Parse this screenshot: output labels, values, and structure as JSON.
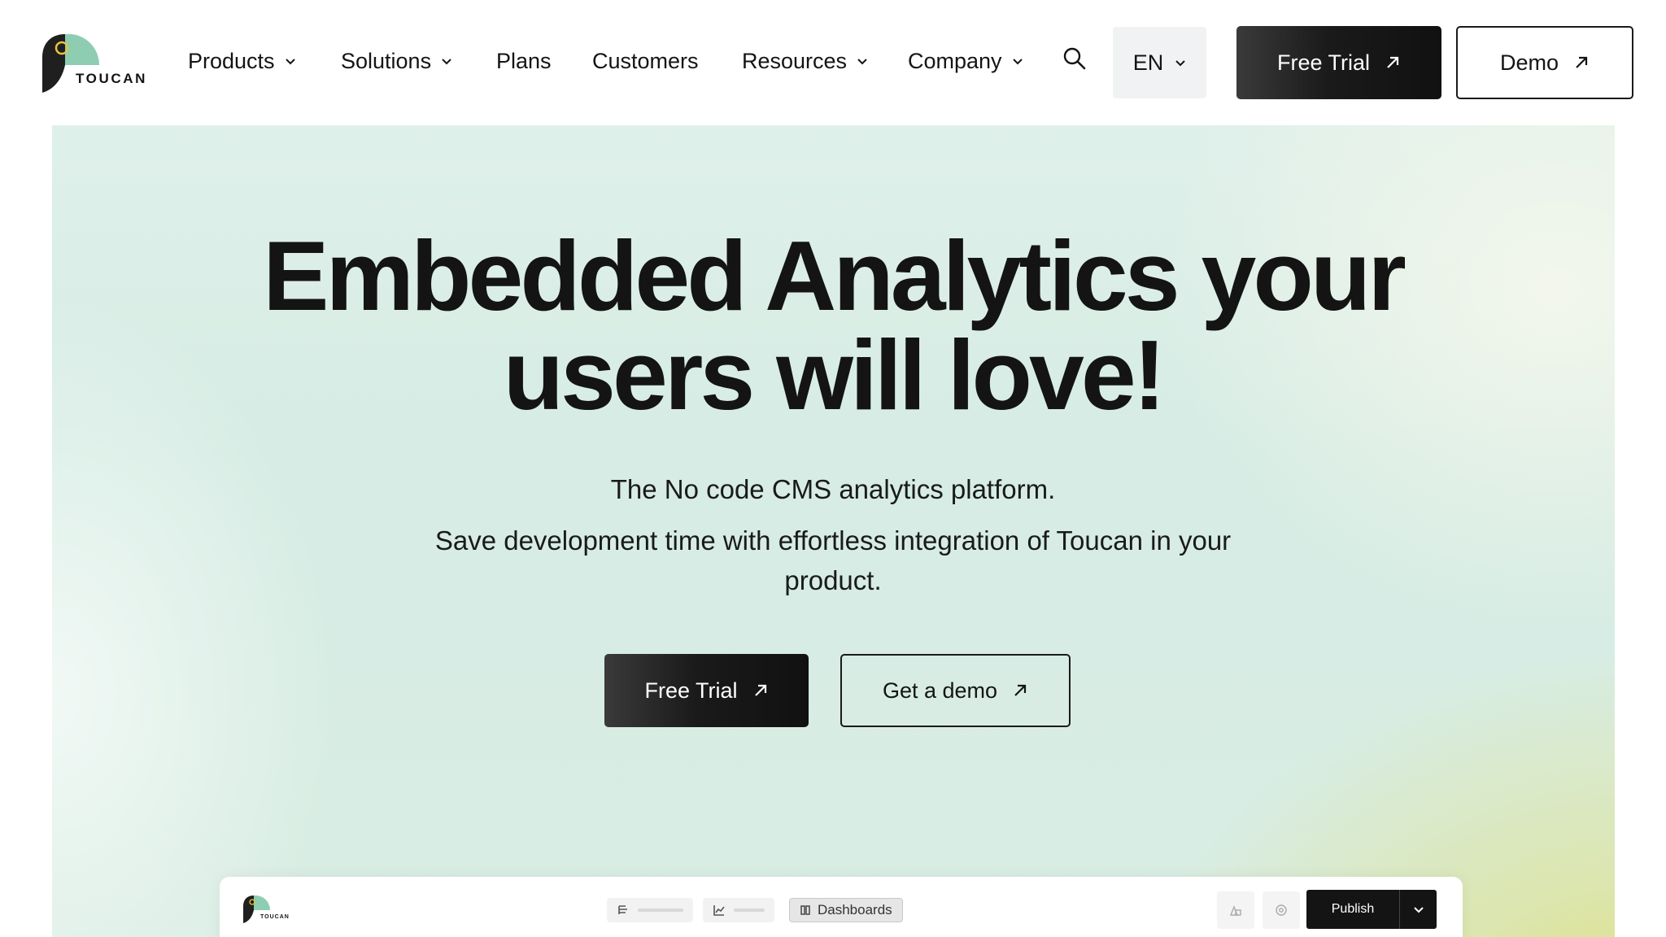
{
  "brand": {
    "name": "TOUCAN"
  },
  "nav": {
    "items": [
      {
        "label": "Products",
        "dropdown": true
      },
      {
        "label": "Solutions",
        "dropdown": true
      },
      {
        "label": "Plans",
        "dropdown": false
      },
      {
        "label": "Customers",
        "dropdown": false
      },
      {
        "label": "Resources",
        "dropdown": true
      },
      {
        "label": "Company",
        "dropdown": true
      }
    ],
    "language": "EN",
    "free_trial_label": "Free Trial",
    "demo_label": "Demo"
  },
  "hero": {
    "headline_line1": "Embedded Analytics your",
    "headline_line2": "users will love!",
    "subtitle": "The No code CMS analytics platform.",
    "description": "Save development time with effortless integration of Toucan in your product.",
    "primary_cta": "Free Trial",
    "secondary_cta": "Get a demo"
  },
  "preview": {
    "brand": "TOUCAN",
    "active_tab": "Dashboards",
    "publish_label": "Publish"
  },
  "colors": {
    "dark": "#141414",
    "logo_green": "#8fcdb3",
    "logo_dark": "#1f1f1f",
    "logo_eye": "#e7c43a",
    "hero_mint": "#d6ece4",
    "hero_yellow": "#e0dd64"
  },
  "icons": [
    "toucan-logo",
    "chevron-down-icon",
    "search-icon",
    "arrow-up-right-icon",
    "text-block-icon",
    "line-chart-icon",
    "columns-icon",
    "shapes-icon",
    "settings-icon"
  ]
}
